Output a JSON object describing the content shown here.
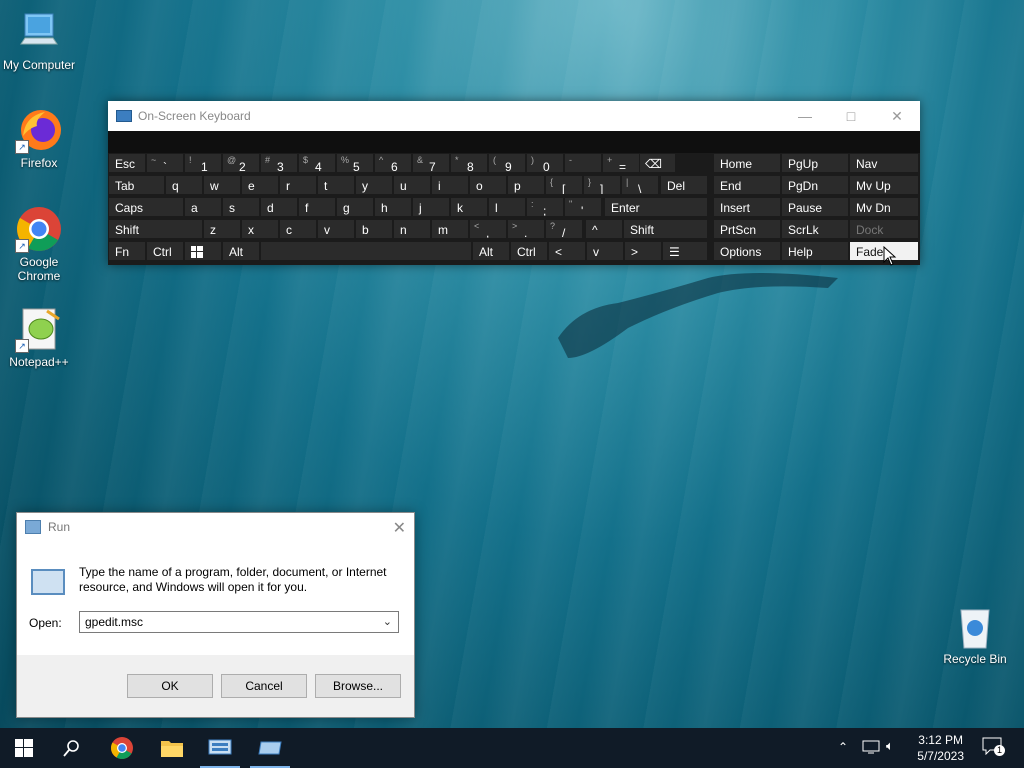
{
  "desktop": {
    "icons": [
      {
        "label": "My Computer",
        "icon": "computer-icon"
      },
      {
        "label": "Firefox",
        "icon": "firefox-icon"
      },
      {
        "label": "Google Chrome",
        "icon": "chrome-icon"
      },
      {
        "label": "Notepad++",
        "icon": "notepad-plus-plus-icon"
      },
      {
        "label": "Recycle Bin",
        "icon": "recycle-bin-icon"
      }
    ]
  },
  "osk": {
    "title": "On-Screen Keyboard",
    "row1": [
      "Esc",
      "~",
      "`",
      "!",
      "1",
      "@",
      "2",
      "#",
      "3",
      "$",
      "4",
      "%",
      "5",
      "^",
      "6",
      "&",
      "7",
      "*",
      "8",
      "(",
      "9",
      ")",
      "0",
      "-",
      "_",
      "+",
      "=",
      "⌫"
    ],
    "keys": {
      "esc": "Esc",
      "tab": "Tab",
      "caps": "Caps",
      "shift": "Shift",
      "fn": "Fn",
      "ctrl": "Ctrl",
      "alt": "Alt",
      "enter": "Enter",
      "del": "Del",
      "shift_r": "Shift",
      "alt_r": "Alt",
      "ctrl_r": "Ctrl",
      "home": "Home",
      "pgup": "PgUp",
      "nav": "Nav",
      "end": "End",
      "pgdn": "PgDn",
      "mvup": "Mv Up",
      "insert": "Insert",
      "pause": "Pause",
      "mvdn": "Mv Dn",
      "prtscn": "PrtScn",
      "scrlk": "ScrLk",
      "dock": "Dock",
      "options": "Options",
      "help": "Help",
      "fade": "Fade"
    },
    "num_keys": [
      {
        "sh": "~",
        "mn": "`"
      },
      {
        "sh": "!",
        "mn": "1"
      },
      {
        "sh": "@",
        "mn": "2"
      },
      {
        "sh": "#",
        "mn": "3"
      },
      {
        "sh": "$",
        "mn": "4"
      },
      {
        "sh": "%",
        "mn": "5"
      },
      {
        "sh": "^",
        "mn": "6"
      },
      {
        "sh": "&",
        "mn": "7"
      },
      {
        "sh": "*",
        "mn": "8"
      },
      {
        "sh": "(",
        "mn": "9"
      },
      {
        "sh": ")",
        "mn": "0"
      },
      {
        "sh": "-",
        "mn": "_"
      },
      {
        "sh": "+",
        "mn": "="
      }
    ],
    "row_q": [
      "q",
      "w",
      "e",
      "r",
      "t",
      "y",
      "u",
      "i",
      "o",
      "p"
    ],
    "row_q_extra": [
      {
        "sh": "{",
        "mn": "["
      },
      {
        "sh": "}",
        "mn": "]"
      },
      {
        "sh": "|",
        "mn": "\\"
      }
    ],
    "row_a": [
      "a",
      "s",
      "d",
      "f",
      "g",
      "h",
      "j",
      "k",
      "l"
    ],
    "row_a_extra": [
      {
        "sh": ":",
        "mn": ";"
      },
      {
        "sh": "\"",
        "mn": "'"
      }
    ],
    "row_z": [
      "z",
      "x",
      "c",
      "v",
      "b",
      "n",
      "m"
    ],
    "row_z_extra": [
      {
        "sh": "<",
        "mn": ","
      },
      {
        "sh": ">",
        "mn": "."
      },
      {
        "sh": "?",
        "mn": "/"
      }
    ]
  },
  "run": {
    "title": "Run",
    "description": "Type the name of a program, folder, document, or Internet resource, and Windows will open it for you.",
    "open_label": "Open:",
    "open_value": "gpedit.msc",
    "ok": "OK",
    "cancel": "Cancel",
    "browse": "Browse..."
  },
  "taskbar": {
    "time": "3:12 PM",
    "date": "5/7/2023",
    "notification_count": "1"
  }
}
